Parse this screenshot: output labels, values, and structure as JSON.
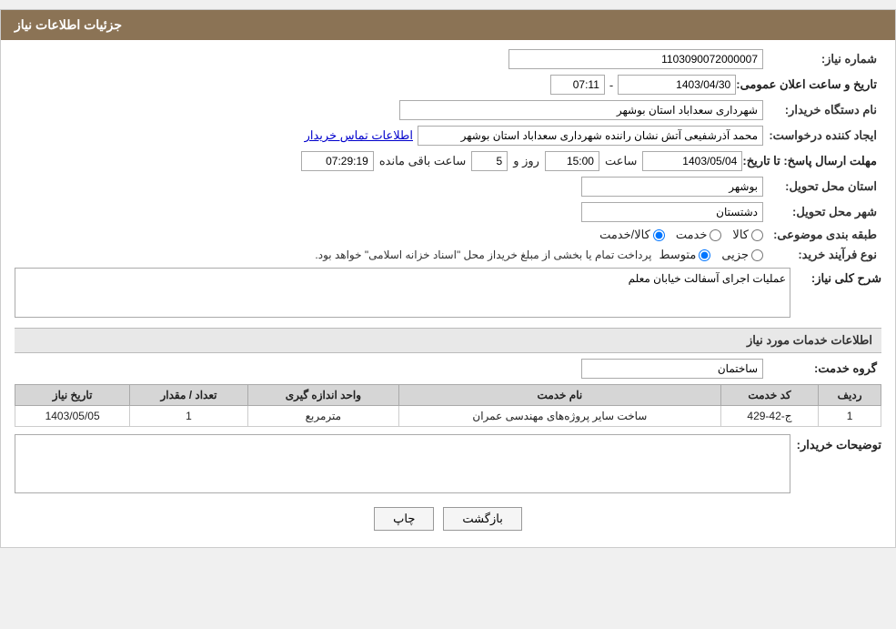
{
  "header": {
    "title": "جزئیات اطلاعات نیاز"
  },
  "labels": {
    "need_number": "شماره نیاز:",
    "buyer_org": "نام دستگاه خریدار:",
    "creator": "ایجاد کننده درخواست:",
    "deadline": "مهلت ارسال پاسخ: تا تاریخ:",
    "delivery_province": "استان محل تحویل:",
    "delivery_city": "شهر محل تحویل:",
    "subject_category": "طبقه بندی موضوعی:",
    "purchase_type": "نوع فرآیند خرید:",
    "description": "شرح کلی نیاز:",
    "service_info": "اطلاعات خدمات مورد نیاز",
    "service_group": "گروه خدمت:",
    "buyer_notes": "توضیحات خریدار:",
    "announce_date": "تاریخ و ساعت اعلان عمومی:",
    "contact_info": "اطلاعات تماس خریدار"
  },
  "values": {
    "need_number": "1103090072000007",
    "buyer_org": "شهرداری سعداباد استان بوشهر",
    "creator_name": "محمد آذرشفیعی آتش نشان راننده شهرداری سعداباد استان بوشهر",
    "deadline_date": "1403/05/04",
    "deadline_time": "15:00",
    "deadline_days": "5",
    "deadline_remaining": "07:29:19",
    "delivery_province": "بوشهر",
    "delivery_city": "دشتستان",
    "service_group_val": "ساختمان",
    "announce_from": "1403/04/30",
    "announce_time": "07:11",
    "description_text": "عملیات اجرای آسفالت خیابان معلم",
    "purchase_notice": "پرداخت تمام یا بخشی از مبلغ خریداز محل \"اسناد خزانه اسلامی\" خواهد بود."
  },
  "radio_groups": {
    "subject": {
      "options": [
        "کالا",
        "خدمت",
        "کالا/خدمت"
      ],
      "selected": 2
    },
    "purchase_type": {
      "options": [
        "جزیی",
        "متوسط"
      ],
      "selected": 1
    }
  },
  "table": {
    "headers": [
      "ردیف",
      "کد خدمت",
      "نام خدمت",
      "واحد اندازه گیری",
      "تعداد / مقدار",
      "تاریخ نیاز"
    ],
    "rows": [
      {
        "row": "1",
        "code": "ج-42-429",
        "name": "ساخت سایر پروژه‌های مهندسی عمران",
        "unit": "مترمربع",
        "count": "1",
        "date": "1403/05/05"
      }
    ]
  },
  "buttons": {
    "print": "چاپ",
    "back": "بازگشت"
  },
  "days_label": "روز و",
  "remaining_label": "ساعت باقی مانده"
}
